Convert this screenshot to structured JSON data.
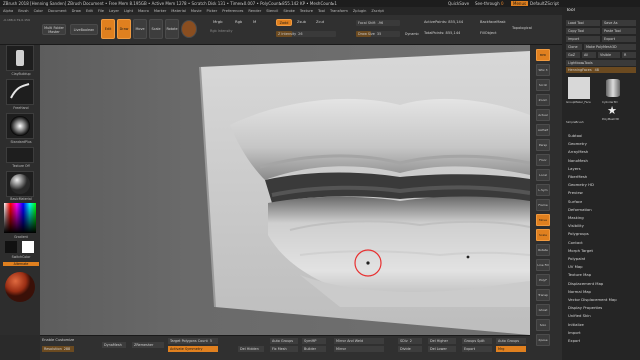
{
  "titlebar": {
    "title": "ZBrush 2018 [Henning Sanden]   ZBrush Document   • Free Mem 8.195GB • Active Mem 1278 • Scratch Disk 131 • Timer▸0.007 • PolyCount▸855.142 KP • MeshCount▸1",
    "quicksave": "QuickSave",
    "see_through": "See-through",
    "see_through_value": "0",
    "menus_btn": "Menus",
    "default_script": "DefaultZScript"
  },
  "menubar": [
    "Alpha",
    "Brush",
    "Color",
    "Document",
    "Draw",
    "Edit",
    "File",
    "Layer",
    "Light",
    "Macro",
    "Marker",
    "Material",
    "Movie",
    "Picker",
    "Preferences",
    "Render",
    "Stencil",
    "Stroke",
    "Texture",
    "Tool",
    "Transform",
    "Zplugin",
    "Zscript"
  ],
  "toptool": {
    "coords": "-0.188,0.79,0.159",
    "buttons": {
      "history": "Multi Folder\nMaster",
      "lightbox": "LiveBoolean",
      "edit": "Edit",
      "draw": "Draw",
      "move": "Move",
      "scale": "Scale",
      "rotate": "Rotate"
    },
    "mrgb": "Mrgb",
    "rgb": "Rgb",
    "m": "M",
    "zadd": "Zadd",
    "zsub": "Zsub",
    "zcut": "Zcut",
    "rgb_intensity": "Rgb Intensity",
    "z_intensity_label": "Z Intensity",
    "z_intensity_value": "26",
    "focal_shift_label": "Focal Shift",
    "focal_shift_value": "-96",
    "draw_size_label": "Draw Size",
    "draw_size_value": "35",
    "dynamic": "Dynamic",
    "active_points": "ActivePoints: 855,144",
    "total_points": "TotalPoints: 855,144",
    "backface": "BackfaceMask",
    "fillobject": "FillObject",
    "topological": "Topological"
  },
  "leftshelf": {
    "brush1": "ClayBuildup",
    "brush2": "FreeHand",
    "brush3": "StandardPlus",
    "texture": "Texture Off",
    "material": "BasicMaterial",
    "gradient": "Gradient",
    "switchcolor": "SwitchColor",
    "alternate": "Alternate"
  },
  "canvas": {
    "cursor_label": "Brush cursor",
    "bg_color": "#6e6e6e"
  },
  "righticons": [
    "BPR",
    "SPix 3",
    "Scroll",
    "Zoom",
    "Actual",
    "AAHalf",
    "Persp",
    "Floor",
    "Local",
    "L.Sym",
    "Frame",
    "Move",
    "Scale",
    "Rotate",
    "Line Fill",
    "PolyF",
    "Transp",
    "Ghost",
    "Solo",
    "Xpose"
  ],
  "toolpanel": {
    "header": "Tool",
    "row1": [
      "Load Tool",
      "Save As"
    ],
    "row2": [
      "Copy Tool",
      "Paste Tool"
    ],
    "row3": [
      "Import",
      "Export"
    ],
    "row4": [
      "Clone",
      "Make PolyMesh3D"
    ],
    "row5": [
      "GoZ",
      "All",
      "Visible",
      "R"
    ],
    "lightbox": "Lightbox▸Tools",
    "current": "HenningFaces",
    "current_value": "48",
    "thumb1": "GroupMaker_Face",
    "thumb2": "Cylinder3D",
    "thumb3": "SimpleBrush",
    "thumb4": "PolyMesh3D",
    "menu": [
      "Subtool",
      "Geometry",
      "ArrayMesh",
      "NanoMesh",
      "Layers",
      "FiberMesh",
      "Geometry HD",
      "Preview",
      "Surface",
      "Deformation",
      "Masking",
      "Visibility",
      "Polygroups",
      "Contact",
      "Morph Target",
      "Polypaint",
      "UV Map",
      "Texture Map",
      "Displacement Map",
      "Normal Map",
      "Vector Displacement Map",
      "Display Properties",
      "Unified Skin",
      "Initialize",
      "Import",
      "Export"
    ]
  },
  "bottombar": {
    "enable_customize": "Enable Customize",
    "resolution_label": "Resolution",
    "resolution_value": "288",
    "dynamesh": "DynaMesh",
    "zremesher": "ZRemesher",
    "target_poly": "Target Polygons Count",
    "target_poly_value": "5",
    "activate_symmetry": "Activate Symmetry",
    "del_hidden": "Del Hidden",
    "auto_groups": "Auto Groups",
    "fix_mesh": "Fix Mesh",
    "sym_mode": "SymMP",
    "mirror_weld": "Mirror And Weld",
    "mirror": "Mirror",
    "sdiv": "SDiv",
    "sdiv_value": "2",
    "del_lower": "Del Lower",
    "groups_split": "Groups Split",
    "export": "Export",
    "auto_groups2": "Auto Groups",
    "merge": "Mrg",
    "divide": "Divide",
    "del_higher": "Del Higher",
    "builder": "Builder",
    "x_sym": "X Sym"
  }
}
